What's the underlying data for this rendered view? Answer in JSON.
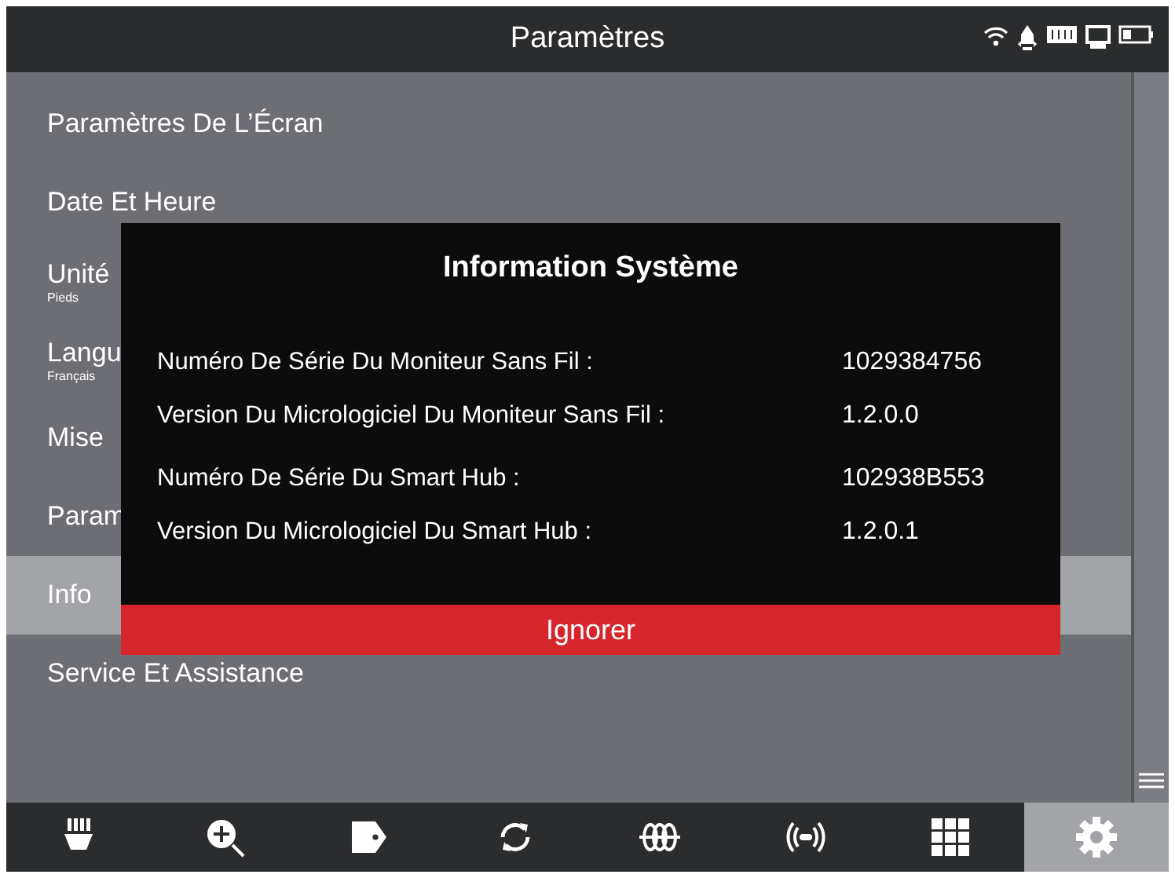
{
  "header": {
    "title": "Paramètres"
  },
  "menu": [
    {
      "label": "Paramètres De L’Écran",
      "selected": false
    },
    {
      "label": "Date Et Heure",
      "selected": false
    },
    {
      "label": "Unité",
      "sub": "Pieds",
      "selected": false
    },
    {
      "label": "Langu",
      "sub": "Français",
      "selected": false
    },
    {
      "label": "Mise",
      "selected": false
    },
    {
      "label": "Param",
      "selected": false
    },
    {
      "label": "Info",
      "selected": true
    },
    {
      "label": "Service Et Assistance",
      "selected": false
    }
  ],
  "dialog": {
    "title": "Information Système",
    "rows": [
      {
        "label": "Numéro De Série Du Moniteur Sans Fil :",
        "value": "1029384756"
      },
      {
        "label": "Version Du Micrologiciel Du Moniteur Sans Fil :",
        "value": "1.2.0.0"
      },
      {
        "label": "Numéro De Série Du Smart Hub :",
        "value": "102938B553"
      },
      {
        "label": "Version Du Micrologiciel Du Smart Hub :",
        "value": "1.2.0.1"
      }
    ],
    "button": "Ignorer"
  },
  "nav": [
    {
      "kind": "light",
      "selected": false
    },
    {
      "kind": "zoom",
      "selected": false
    },
    {
      "kind": "tag",
      "selected": false
    },
    {
      "kind": "rotate",
      "selected": false
    },
    {
      "kind": "coil",
      "selected": false
    },
    {
      "kind": "signal",
      "selected": false
    },
    {
      "kind": "grid",
      "selected": false
    },
    {
      "kind": "gear",
      "selected": true
    }
  ]
}
